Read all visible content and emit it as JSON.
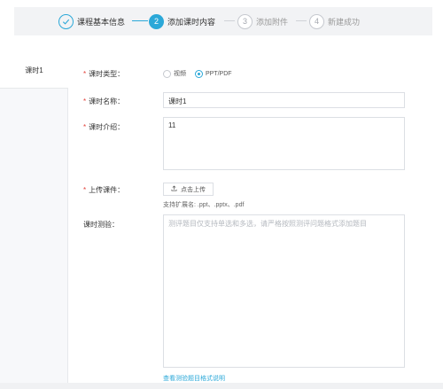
{
  "stepper": {
    "steps": [
      {
        "label": "课程基本信息",
        "number": "",
        "state": "done"
      },
      {
        "label": "添加课时内容",
        "number": "2",
        "state": "active"
      },
      {
        "label": "添加附件",
        "number": "3",
        "state": "todo"
      },
      {
        "label": "新建成功",
        "number": "4",
        "state": "todo"
      }
    ],
    "check_glyph": "✓",
    "accent_color": "#2ba8d8"
  },
  "sidebar": {
    "items": [
      {
        "label": "课时1"
      }
    ]
  },
  "form": {
    "required_mark": "*",
    "type": {
      "label": "课时类型：",
      "options": [
        {
          "label": "视频",
          "checked": false
        },
        {
          "label": "PPT/PDF",
          "checked": true
        }
      ]
    },
    "name": {
      "label": "课时名称：",
      "value": "课时1"
    },
    "intro": {
      "label": "课时介绍：",
      "value": "11"
    },
    "upload": {
      "label": "上传课件：",
      "button_label": "点击上传",
      "icon": "upload-icon",
      "hint": "支持扩展名: .ppt、.pptx、.pdf"
    },
    "quiz": {
      "label": "课时测验：",
      "placeholder": "测评题目仅支持单选和多选，请严格按照测评问题格式添加题目"
    },
    "format_link": "查看测验题目格式说明"
  }
}
